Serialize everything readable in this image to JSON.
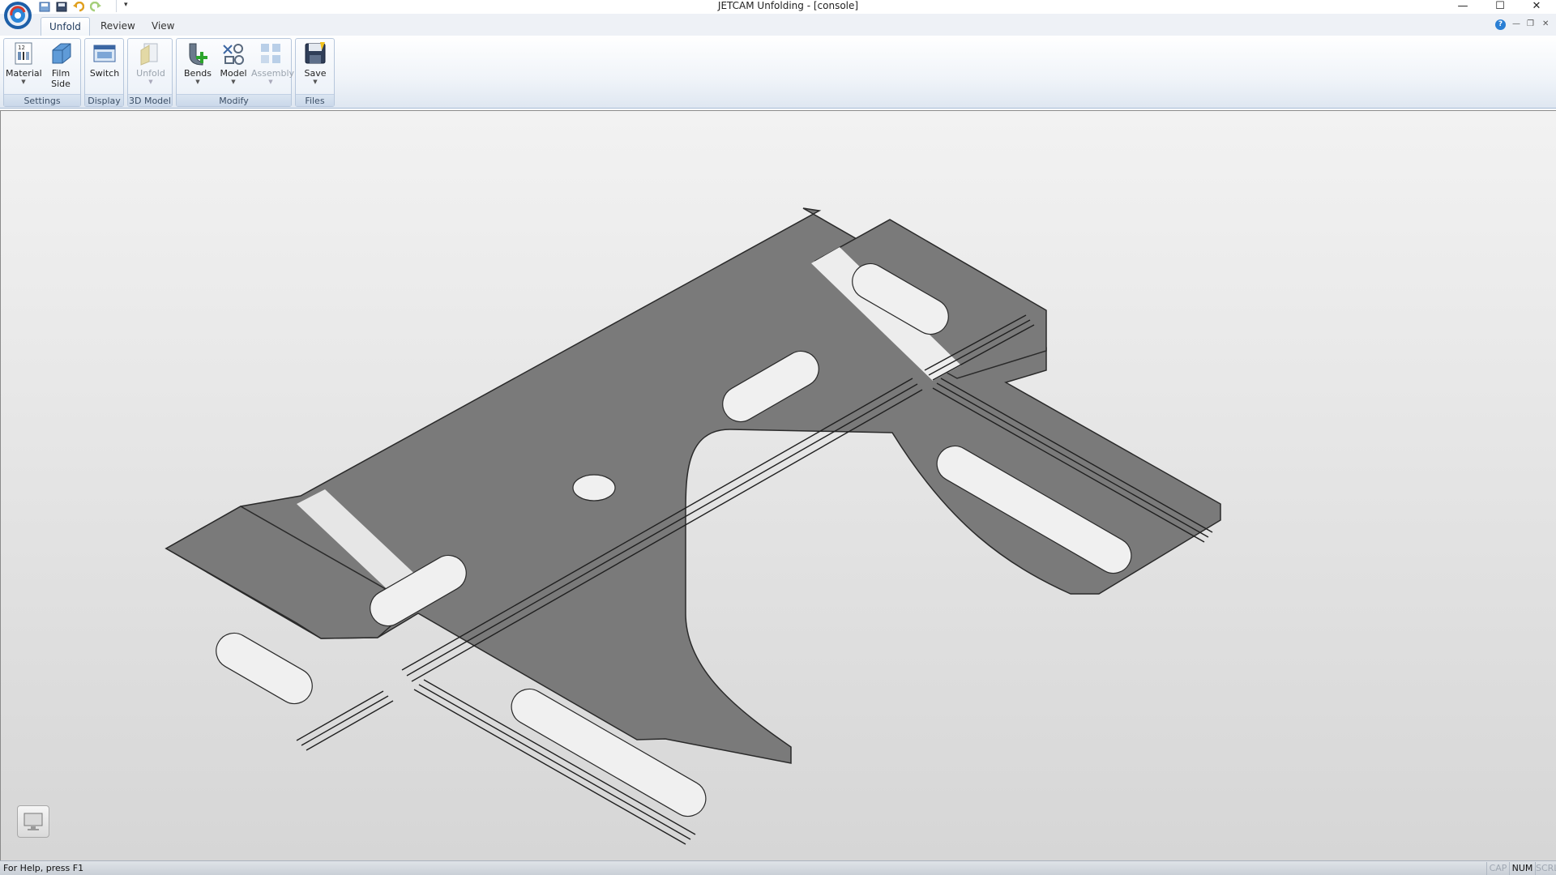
{
  "window": {
    "title": "JETCAM Unfolding - [console]",
    "minimize": "—",
    "maximize": "☐",
    "close": "✕"
  },
  "tabs": [
    {
      "label": "Unfold",
      "active": true
    },
    {
      "label": "Review",
      "active": false
    },
    {
      "label": "View",
      "active": false
    }
  ],
  "groups": {
    "settings": {
      "label": "Settings",
      "buttons": [
        {
          "label": "Material",
          "icon": "material-icon",
          "dropdown": true
        },
        {
          "label": "Film\nSide",
          "icon": "film-side-icon",
          "dropdown": false
        }
      ]
    },
    "display": {
      "label": "Display",
      "buttons": [
        {
          "label": "Switch",
          "icon": "switch-icon",
          "dropdown": false
        }
      ]
    },
    "model3d": {
      "label": "3D Model",
      "buttons": [
        {
          "label": "Unfold",
          "icon": "unfold-icon",
          "dropdown": true,
          "disabled": true
        }
      ]
    },
    "modify": {
      "label": "Modify",
      "buttons": [
        {
          "label": "Bends",
          "icon": "bends-icon",
          "dropdown": true
        },
        {
          "label": "Model",
          "icon": "model-icon",
          "dropdown": true
        },
        {
          "label": "Assembly",
          "icon": "assembly-icon",
          "dropdown": true,
          "disabled": true
        }
      ]
    },
    "files": {
      "label": "Files",
      "buttons": [
        {
          "label": "Save",
          "icon": "save-icon",
          "dropdown": true
        }
      ]
    }
  },
  "status": {
    "help_text": "For Help, press F1",
    "indicators": [
      {
        "label": "CAP",
        "on": false
      },
      {
        "label": "NUM",
        "on": true
      },
      {
        "label": "SCRL",
        "on": false
      }
    ]
  },
  "colors": {
    "part_fill": "#7a7a7a",
    "part_edge": "#2a2a2a",
    "accent": "#2a7fd4"
  }
}
